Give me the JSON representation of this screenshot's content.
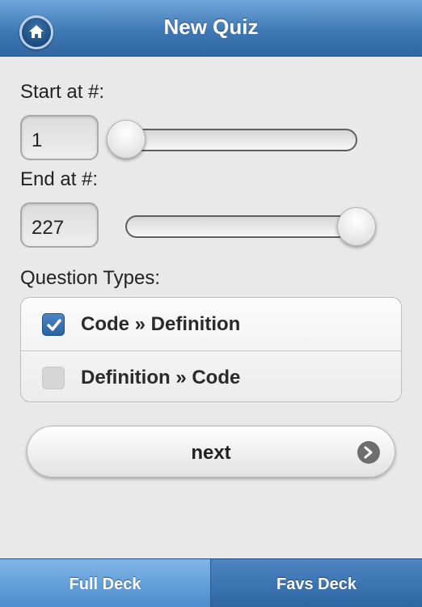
{
  "header": {
    "title": "New Quiz"
  },
  "start": {
    "label": "Start at #:",
    "value": "1",
    "slider_fraction": 0
  },
  "end": {
    "label": "End at #:",
    "value": "227",
    "slider_fraction": 1
  },
  "question_types": {
    "label": "Question Types:",
    "items": [
      {
        "label": "Code » Definition",
        "checked": true
      },
      {
        "label": "Definition » Code",
        "checked": false
      }
    ]
  },
  "next_button": {
    "label": "next"
  },
  "tabs": [
    {
      "label": "Full Deck",
      "active": true
    },
    {
      "label": "Favs Deck",
      "active": false
    }
  ],
  "colors": {
    "accent": "#3f78b4",
    "checkbox": "#2a63a4"
  }
}
